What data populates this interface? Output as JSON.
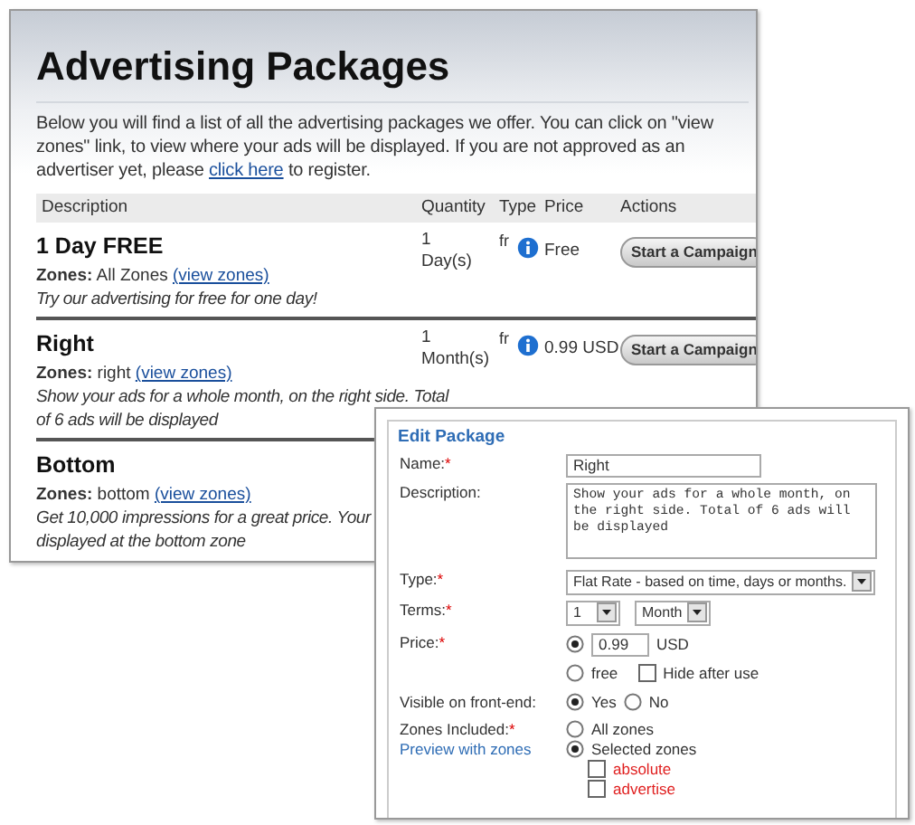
{
  "listing": {
    "title": "Advertising Packages",
    "intro": {
      "before": "Below you will find a list of all the advertising packages we offer. You can click on \"view zones\" link, to view where your ads will be displayed. If you are not approved as an advertiser yet, please",
      "link": "click here",
      "after": "to register."
    },
    "columns": [
      "Description",
      "Quantity",
      "Type",
      "Price",
      "Actions"
    ],
    "packages": [
      {
        "name": "1 Day FREE",
        "zones_label": "Zones:",
        "zones_value": "All Zones",
        "view_link": "(view zones)",
        "description_lines": [
          "Try our advertising for free for one day!"
        ],
        "quantity": "1 Day(s)",
        "type": "fr",
        "price": "Free",
        "action": "Start a Campaign"
      },
      {
        "name": "Right",
        "zones_label": "Zones:",
        "zones_value": "right",
        "view_link": "(view zones)",
        "description_lines": [
          "Show your ads for a whole month, on the right side. Total",
          "of 6 ads will be displayed"
        ],
        "quantity": "1 Month(s)",
        "type": "fr",
        "price": "0.99 USD",
        "action": "Start a Campaign"
      },
      {
        "name": "Bottom",
        "zones_label": "Zones:",
        "zones_value": "bottom",
        "view_link": "(view zones)",
        "description_lines": [
          "Get 10,000 impressions for a great price. Your",
          "displayed at the bottom zone"
        ]
      }
    ]
  },
  "edit_package": {
    "legend": "Edit Package",
    "fields": [
      {
        "kind": "text",
        "label": "Name:",
        "mark": "*",
        "value": "Right"
      },
      {
        "kind": "textarea",
        "label": "Description:",
        "value": "Show your ads for a whole month, on the right side. Total of 6 ads will be displayed"
      },
      {
        "kind": "select",
        "label": "Type:",
        "mark": "*",
        "value": "Flat Rate - based on time, days or months."
      },
      {
        "kind": "terms",
        "label": "Terms:",
        "mark": "*",
        "selects": [
          "1",
          "Month"
        ]
      },
      {
        "kind": "price",
        "label": "Price:",
        "mark": "*",
        "amount": {
          "selected": true,
          "value": "0.99",
          "unit": "USD"
        },
        "free": {
          "selected": false,
          "label": "free"
        },
        "hide_after_use": {
          "label": "Hide after use",
          "checked": false
        }
      },
      {
        "kind": "visibility",
        "label": "Visible on front-end:",
        "options": [
          {
            "label": "Yes",
            "selected": true
          },
          {
            "label": "No",
            "selected": false
          }
        ]
      },
      {
        "kind": "zones",
        "label": "Zones Included:",
        "mark": "*",
        "link": "Preview with zones",
        "options": [
          {
            "label": "All zones",
            "selected": false
          },
          {
            "label": "Selected zones",
            "selected": true
          }
        ],
        "zones": [
          {
            "label": "absolute",
            "checked": false
          },
          {
            "label": "advertise",
            "checked": false
          }
        ]
      }
    ]
  }
}
